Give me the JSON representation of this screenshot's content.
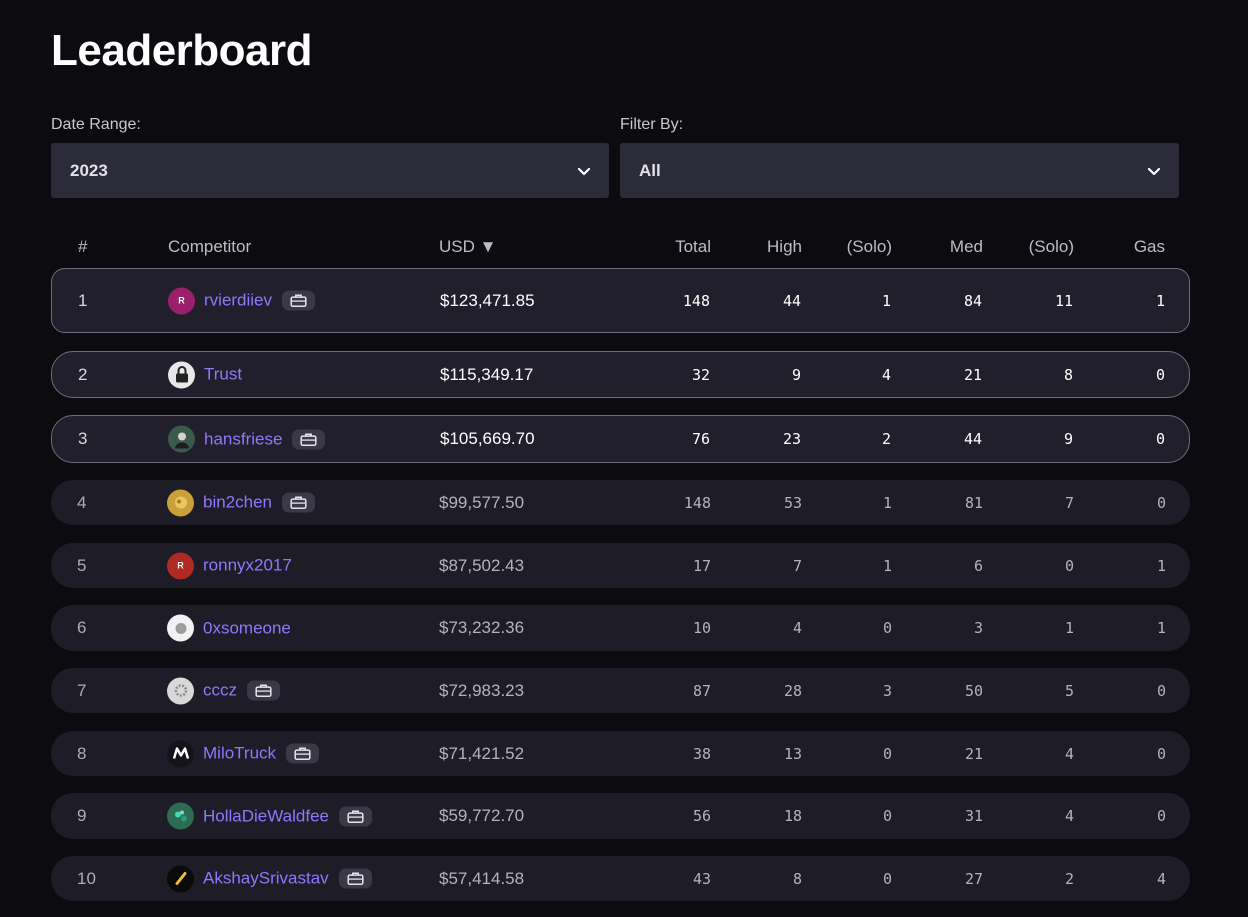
{
  "page": {
    "title": "Leaderboard"
  },
  "filters": {
    "date_range": {
      "label": "Date Range:",
      "value": "2023"
    },
    "filter_by": {
      "label": "Filter By:",
      "value": "All"
    }
  },
  "table": {
    "columns": {
      "rank": "#",
      "competitor": "Competitor",
      "usd": "USD ▼",
      "total": "Total",
      "high": "High",
      "high_solo": "(Solo)",
      "med": "Med",
      "med_solo": "(Solo)",
      "gas": "Gas"
    },
    "rows": [
      {
        "rank": "1",
        "name": "rvierdiiev",
        "avatar": {
          "letter": "R",
          "color": "#9c1f6b",
          "icon": "letter-avatar"
        },
        "team": true,
        "usd": "$123,471.85",
        "total": "148",
        "high": "44",
        "high_solo": "1",
        "med": "84",
        "med_solo": "11",
        "gas": "1"
      },
      {
        "rank": "2",
        "name": "Trust",
        "avatar": {
          "letter": "",
          "color": "#e8e8e8",
          "icon": "padlock-avatar"
        },
        "team": false,
        "usd": "$115,349.17",
        "total": "32",
        "high": "9",
        "high_solo": "4",
        "med": "21",
        "med_solo": "8",
        "gas": "0"
      },
      {
        "rank": "3",
        "name": "hansfriese",
        "avatar": {
          "letter": "",
          "color": "#3b5a4c",
          "icon": "person-avatar"
        },
        "team": true,
        "usd": "$105,669.70",
        "total": "76",
        "high": "23",
        "high_solo": "2",
        "med": "44",
        "med_solo": "9",
        "gas": "0"
      },
      {
        "rank": "4",
        "name": "bin2chen",
        "avatar": {
          "letter": "",
          "color": "#c9a03a",
          "icon": "gold-avatar"
        },
        "team": true,
        "usd": "$99,577.50",
        "total": "148",
        "high": "53",
        "high_solo": "1",
        "med": "81",
        "med_solo": "7",
        "gas": "0"
      },
      {
        "rank": "5",
        "name": "ronnyx2017",
        "avatar": {
          "letter": "R",
          "color": "#b02a25",
          "icon": "letter-avatar"
        },
        "team": false,
        "usd": "$87,502.43",
        "total": "17",
        "high": "7",
        "high_solo": "1",
        "med": "6",
        "med_solo": "0",
        "gas": "1"
      },
      {
        "rank": "6",
        "name": "0xsomeone",
        "avatar": {
          "letter": "",
          "color": "#f2f2f2",
          "icon": "blob-avatar"
        },
        "team": false,
        "usd": "$73,232.36",
        "total": "10",
        "high": "4",
        "high_solo": "0",
        "med": "3",
        "med_solo": "1",
        "gas": "1"
      },
      {
        "rank": "7",
        "name": "cccz",
        "avatar": {
          "letter": "",
          "color": "#d8d8d8",
          "icon": "gear-avatar"
        },
        "team": true,
        "usd": "$72,983.23",
        "total": "87",
        "high": "28",
        "high_solo": "3",
        "med": "50",
        "med_solo": "5",
        "gas": "0"
      },
      {
        "rank": "8",
        "name": "MiloTruck",
        "avatar": {
          "letter": "",
          "color": "#14131a",
          "icon": "m-logo-avatar"
        },
        "team": true,
        "usd": "$71,421.52",
        "total": "38",
        "high": "13",
        "high_solo": "0",
        "med": "21",
        "med_solo": "4",
        "gas": "0"
      },
      {
        "rank": "9",
        "name": "HollaDieWaldfee",
        "avatar": {
          "letter": "",
          "color": "#2e6b55",
          "icon": "forest-avatar"
        },
        "team": true,
        "usd": "$59,772.70",
        "total": "56",
        "high": "18",
        "high_solo": "0",
        "med": "31",
        "med_solo": "4",
        "gas": "0"
      },
      {
        "rank": "10",
        "name": "AkshaySrivastav",
        "avatar": {
          "letter": "",
          "color": "#0a0a0a",
          "icon": "pen-avatar"
        },
        "team": true,
        "usd": "$57,414.58",
        "total": "43",
        "high": "8",
        "high_solo": "0",
        "med": "27",
        "med_solo": "2",
        "gas": "4"
      }
    ]
  },
  "colors": {
    "background": "#0c0b0f",
    "row": "#1d1c27",
    "select": "#2c2b39",
    "link": "#8f78ff"
  }
}
